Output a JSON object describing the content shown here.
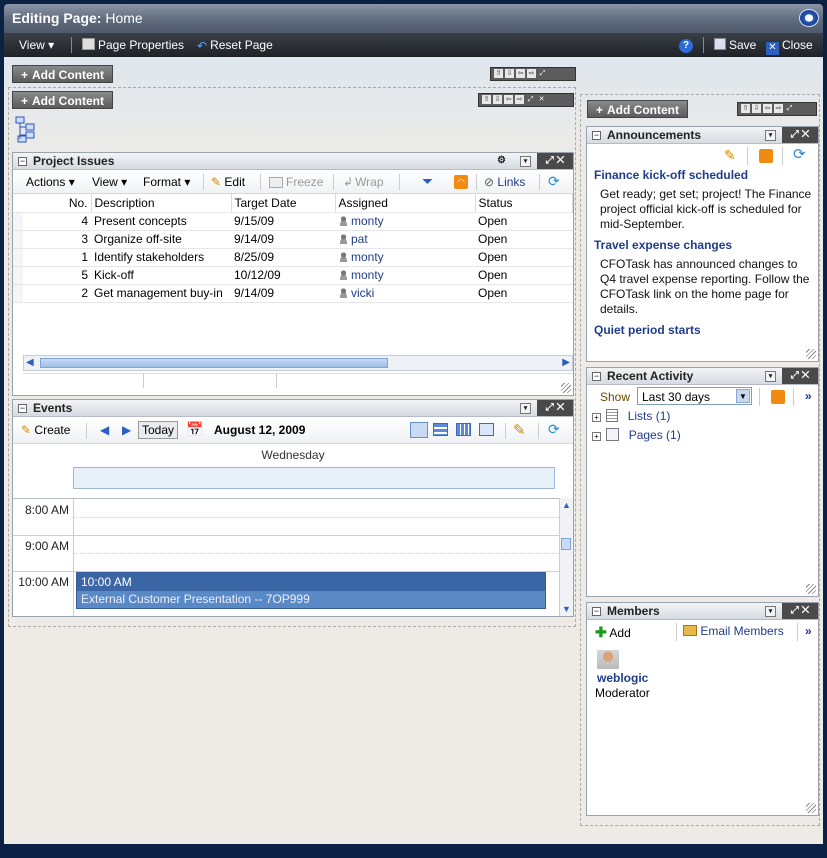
{
  "header": {
    "title_prefix": "Editing Page:",
    "title_page": "Home",
    "logo_icon": "oracle-o-icon"
  },
  "toolbar": {
    "view": "View",
    "page_properties": "Page Properties",
    "reset_page": "Reset Page",
    "save": "Save",
    "close": "Close",
    "help_icon": "help-icon"
  },
  "layout": {
    "add_content": "Add Content"
  },
  "project_issues": {
    "title": "Project Issues",
    "menus": {
      "actions": "Actions",
      "view": "View",
      "format": "Format",
      "edit": "Edit",
      "freeze": "Freeze",
      "wrap": "Wrap",
      "links": "Links"
    },
    "columns": [
      "No.",
      "Description",
      "Target Date",
      "Assigned",
      "Status"
    ],
    "rows": [
      {
        "no": "4",
        "desc": "Present concepts",
        "date": "9/15/09",
        "assigned": "monty",
        "status": "Open"
      },
      {
        "no": "3",
        "desc": "Organize off-site",
        "date": "9/14/09",
        "assigned": "pat",
        "status": "Open"
      },
      {
        "no": "1",
        "desc": "Identify stakeholders",
        "date": "8/25/09",
        "assigned": "monty",
        "status": "Open"
      },
      {
        "no": "5",
        "desc": "Kick-off",
        "date": "10/12/09",
        "assigned": "monty",
        "status": "Open"
      },
      {
        "no": "2",
        "desc": "Get management buy-in",
        "date": "9/14/09",
        "assigned": "vicki",
        "status": "Open"
      }
    ]
  },
  "events": {
    "title": "Events",
    "create": "Create",
    "today": "Today",
    "date": "August 12, 2009",
    "day": "Wednesday",
    "times": [
      "8:00 AM",
      "9:00 AM",
      "10:00 AM"
    ],
    "event_time": "10:00 AM",
    "event_title": "External Customer Presentation -- 7OP999"
  },
  "announcements": {
    "title": "Announcements",
    "items": [
      {
        "title": "Finance kick-off scheduled",
        "body": "Get ready; get set; project! The Finance project official kick-off is scheduled for mid-September."
      },
      {
        "title": "Travel expense changes",
        "body": "CFOTask has announced changes to Q4 travel expense reporting. Follow the CFOTask link on the home page for details."
      },
      {
        "title": "Quiet period starts",
        "body": ""
      }
    ]
  },
  "recent_activity": {
    "title": "Recent Activity",
    "show_label": "Show",
    "range": "Last 30 days",
    "items": [
      "Lists (1)",
      "Pages (1)"
    ]
  },
  "members": {
    "title": "Members",
    "add": "Add",
    "email": "Email Members",
    "user": "weblogic",
    "role": "Moderator"
  }
}
